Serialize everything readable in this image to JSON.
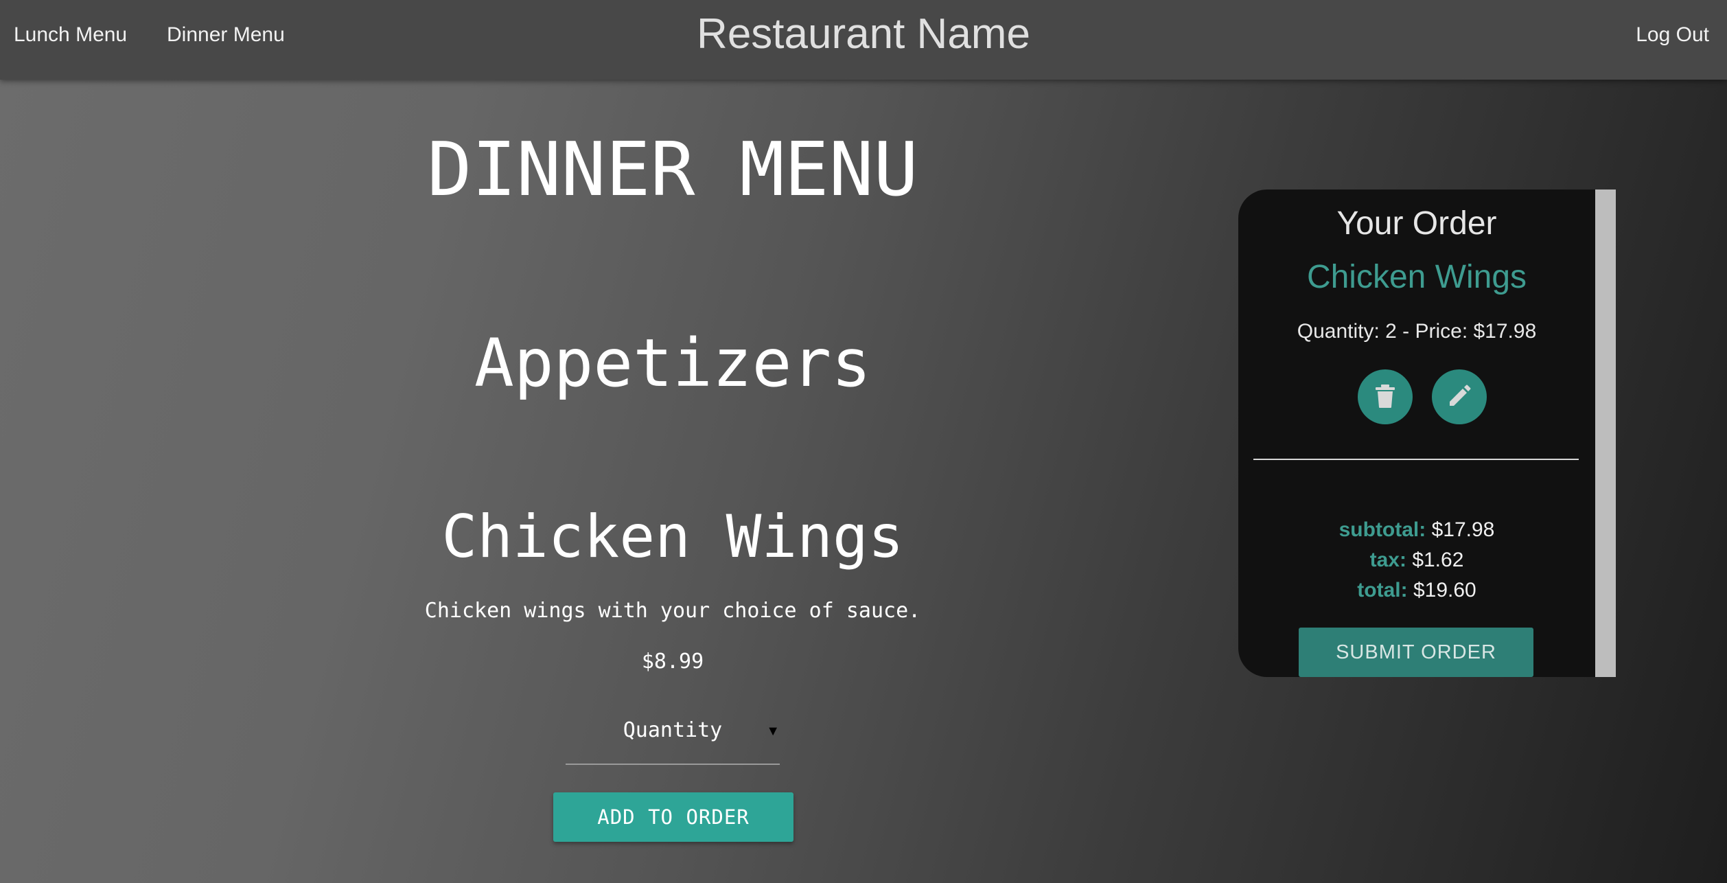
{
  "header": {
    "brand": "Restaurant Name",
    "nav_lunch": "Lunch Menu",
    "nav_dinner": "Dinner Menu",
    "logout": "Log Out"
  },
  "menu": {
    "title": "DINNER MENU",
    "section": "Appetizers",
    "item": {
      "name": "Chicken Wings",
      "description": "Chicken wings with your choice of sauce.",
      "price": "$8.99"
    },
    "quantity_placeholder": "Quantity",
    "add_button": "ADD TO ORDER"
  },
  "order": {
    "heading": "Your Order",
    "items": [
      {
        "name": "Chicken Wings",
        "meta": "Quantity: 2 - Price: $17.98"
      }
    ],
    "subtotal_label": "subtotal:",
    "subtotal_value": "$17.98",
    "tax_label": "tax:",
    "tax_value": "$1.62",
    "total_label": "total:",
    "total_value": "$19.60",
    "submit_button": "SUBMIT ORDER"
  },
  "colors": {
    "accent": "#2ea597",
    "accent_text": "#3e9c90",
    "panel": "#111111"
  },
  "icons": {
    "delete": "trash-icon",
    "edit": "pencil-icon",
    "caret": "caret-down-icon"
  }
}
